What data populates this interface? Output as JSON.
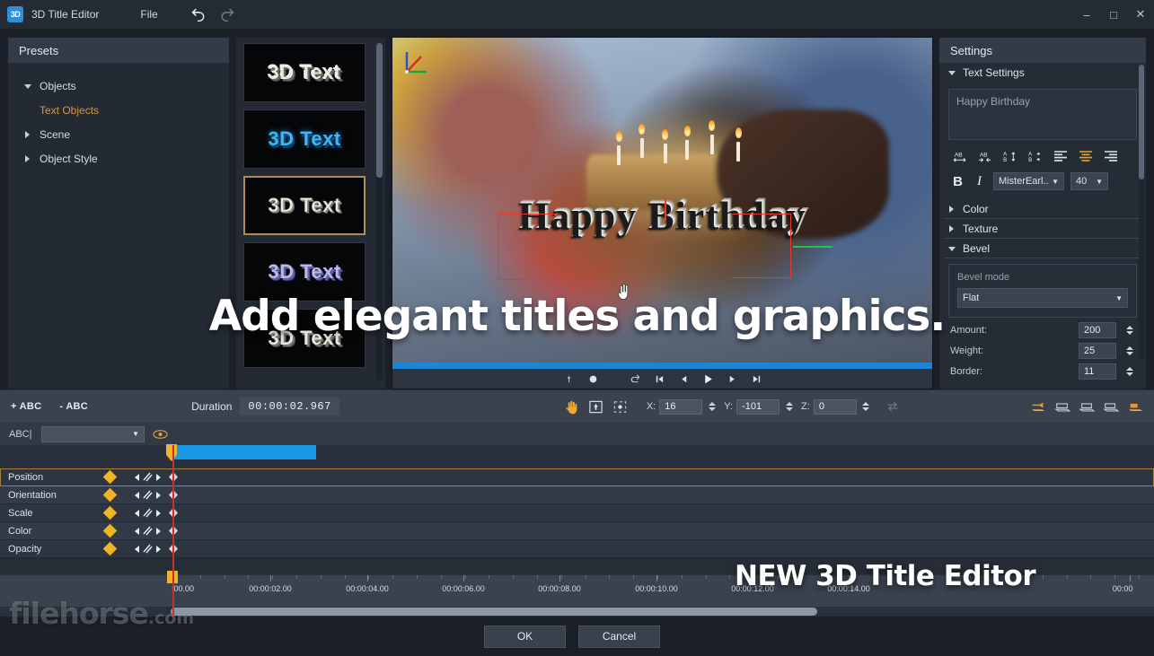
{
  "window": {
    "app_badge": "3D",
    "title": "3D Title Editor",
    "menu": [
      "File"
    ],
    "undo_icon": "undo-arrow-icon",
    "redo_icon": "redo-arrow-icon",
    "minimize": "–",
    "maximize": "□",
    "close": "✕"
  },
  "presets": {
    "header": "Presets",
    "tree": [
      {
        "label": "Objects",
        "state": "expanded",
        "selected": false,
        "child": false
      },
      {
        "label": "Text Objects",
        "state": "leaf",
        "selected": true,
        "child": true
      },
      {
        "label": "Scene",
        "state": "collapsed",
        "selected": false,
        "child": false
      },
      {
        "label": "Object Style",
        "state": "collapsed",
        "selected": false,
        "child": false
      }
    ]
  },
  "thumbnails": {
    "items": [
      {
        "label": "3D Text",
        "style": "t1",
        "selected": false
      },
      {
        "label": "3D Text",
        "style": "t2",
        "selected": false
      },
      {
        "label": "3D Text",
        "style": "t3",
        "selected": true
      },
      {
        "label": "3D Text",
        "style": "t4",
        "selected": false
      },
      {
        "label": "3D Text",
        "style": "t5",
        "selected": false
      }
    ]
  },
  "preview": {
    "title_text": "Happy Birthday",
    "gizmo_icon": "3d-axis-gizmo-icon",
    "transport": [
      "keyframe-prev-icon",
      "keyframe-mark-icon",
      "loop-icon",
      "jump-start-icon",
      "step-back-icon",
      "play-icon",
      "step-forward-icon",
      "jump-end-icon"
    ]
  },
  "settings": {
    "header": "Settings",
    "text_settings": {
      "label": "Text Settings",
      "state": "expanded",
      "text_value": "Happy Birthday",
      "align_icons": [
        "increase-letter-spacing-icon",
        "decrease-letter-spacing-icon",
        "increase-line-spacing-icon",
        "decrease-line-spacing-icon",
        "align-left-icon",
        "align-center-icon",
        "align-right-icon"
      ],
      "active_align": "align-center-icon",
      "bold_label": "B",
      "italic_label": "I",
      "font_family": "MisterEarl...",
      "font_size": "40"
    },
    "sections": [
      {
        "label": "Color",
        "state": "collapsed"
      },
      {
        "label": "Texture",
        "state": "collapsed"
      },
      {
        "label": "Bevel",
        "state": "expanded"
      }
    ],
    "bevel": {
      "mode_label": "Bevel mode",
      "mode_value": "Flat",
      "fields": [
        {
          "label": "Amount:",
          "value": "200"
        },
        {
          "label": "Weight:",
          "value": "25"
        },
        {
          "label": "Border:",
          "value": "11"
        }
      ]
    }
  },
  "timeline_toolbar": {
    "add_text": "+ ABC",
    "remove_text": "- ABC",
    "duration_label": "Duration",
    "duration_value": "00:00:02.967",
    "tools": [
      "pan-hand-icon",
      "move-object-icon",
      "rotate-object-icon"
    ],
    "coords": [
      {
        "axis": "X:",
        "value": "16"
      },
      {
        "axis": "Y:",
        "value": "-101"
      },
      {
        "axis": "Z:",
        "value": "0"
      }
    ],
    "reset_icon": "reset-transform-icon",
    "right_icons": [
      "camera-view-1-icon",
      "camera-view-2-icon",
      "camera-view-3-icon",
      "camera-view-4-icon",
      "camera-view-5-icon"
    ]
  },
  "track": {
    "object_label": "ABC|",
    "object_value": "",
    "visibility_icon": "eye-icon",
    "rows": [
      {
        "label": "Position",
        "selected": true
      },
      {
        "label": "Orientation",
        "selected": false
      },
      {
        "label": "Scale",
        "selected": false
      },
      {
        "label": "Color",
        "selected": false
      },
      {
        "label": "Opacity",
        "selected": false
      }
    ]
  },
  "ruler": {
    "labels": [
      ":00.00",
      "00:00:02.00",
      "00:00:04.00",
      "00:00:06.00",
      "00:00:08.00",
      "00:00:10.00",
      "00:00:12.00",
      "00:00:14.00",
      "00:00"
    ],
    "positions": [
      196,
      301,
      409,
      516,
      623,
      731,
      838,
      945,
      1258
    ]
  },
  "footer": {
    "ok": "OK",
    "cancel": "Cancel"
  },
  "overlay": {
    "watermark": "filehorse",
    "watermark_suffix": ".com",
    "caption_main": "Add elegant titles and graphics.",
    "caption_sub": "NEW 3D Title Editor"
  },
  "colors": {
    "accent_orange": "#d99a3a",
    "accent_blue": "#189ae8",
    "keyframe_yellow": "#f0b429",
    "playhead_red": "#c7322c",
    "panel_bg": "#232a34",
    "window_bg": "#1b2028"
  }
}
